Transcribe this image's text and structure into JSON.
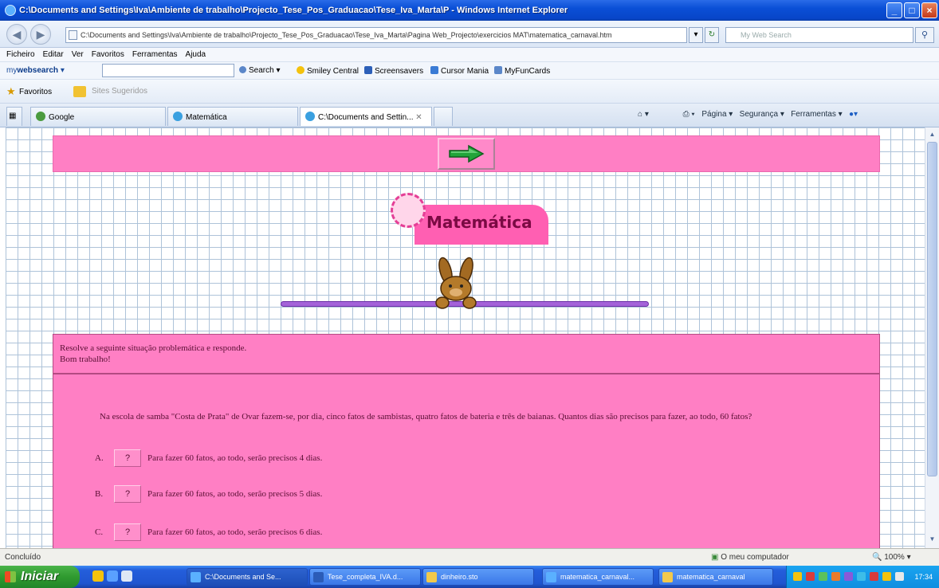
{
  "window": {
    "title": "C:\\Documents and Settings\\Iva\\Ambiente de trabalho\\Projecto_Tese_Pos_Graduacao\\Tese_Iva_Marta\\P - Windows Internet Explorer"
  },
  "address_bar": {
    "url": "C:\\Documents and Settings\\Iva\\Ambiente de trabalho\\Projecto_Tese_Pos_Graduacao\\Tese_Iva_Marta\\Pagina Web_Projecto\\exercicios MAT\\matematica_carnaval.htm",
    "search_placeholder": "My Web Search"
  },
  "menu": [
    "Ficheiro",
    "Editar",
    "Ver",
    "Favoritos",
    "Ferramentas",
    "Ajuda"
  ],
  "toolbar": {
    "brand_prefix": "my",
    "brand_name": "websearch",
    "search_label": "Search",
    "items": [
      "Smiley Central",
      "Screensavers",
      "Cursor Mania",
      "MyFunCards"
    ]
  },
  "favorites": {
    "label": "Favoritos",
    "suggested": "Sites Sugeridos"
  },
  "tabs": [
    {
      "label": "Google",
      "active": false
    },
    {
      "label": "Matemática",
      "active": false
    },
    {
      "label": "C:\\Documents and Settin...",
      "active": true
    }
  ],
  "commands": [
    "Página",
    "Segurança",
    "Ferramentas"
  ],
  "page": {
    "logo_text": "Matemática",
    "instruction_line1": "Resolve a seguinte situação problemática e responde.",
    "instruction_line2": "Bom trabalho!",
    "question": "Na escola de samba \"Costa de Prata\" de Ovar fazem-se, por dia, cinco fatos de sambistas, quatro fatos de bateria e três de baianas. Quantos dias são precisos para fazer, ao todo, 60 fatos?",
    "button_label": "?",
    "options": [
      {
        "letter": "A.",
        "text": "Para fazer 60 fatos, ao todo, serão precisos 4 dias."
      },
      {
        "letter": "B.",
        "text": "Para fazer 60 fatos, ao todo, serão precisos 5 dias."
      },
      {
        "letter": "C.",
        "text": "Para fazer 60 fatos, ao todo, serão precisos 6 dias."
      }
    ]
  },
  "status": {
    "left": "Concluído",
    "zone": "O meu computador",
    "zoom": "100%"
  },
  "taskbar": {
    "start": "Iniciar",
    "tasks": [
      "C:\\Documents and Se...",
      "Tese_completa_IVA.d...",
      "dinheiro.sto",
      "matematica_carnaval...",
      "matematica_carnaval"
    ],
    "clock": "17:34"
  },
  "colors": {
    "page_pink": "#ff7fc4",
    "ie_blue": "#0a4fd6",
    "start_green": "#2f9a2f"
  }
}
